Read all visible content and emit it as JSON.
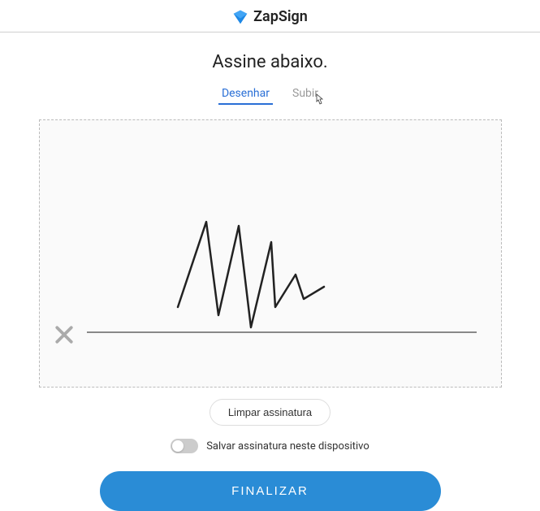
{
  "header": {
    "brand": "ZapSign"
  },
  "heading": "Assine abaixo.",
  "tabs": {
    "draw": "Desenhar",
    "upload": "Subir"
  },
  "actions": {
    "clear": "Limpar assinatura",
    "saveToggle": "Salvar assinatura neste dispositivo",
    "finalize": "FINALIZAR"
  }
}
